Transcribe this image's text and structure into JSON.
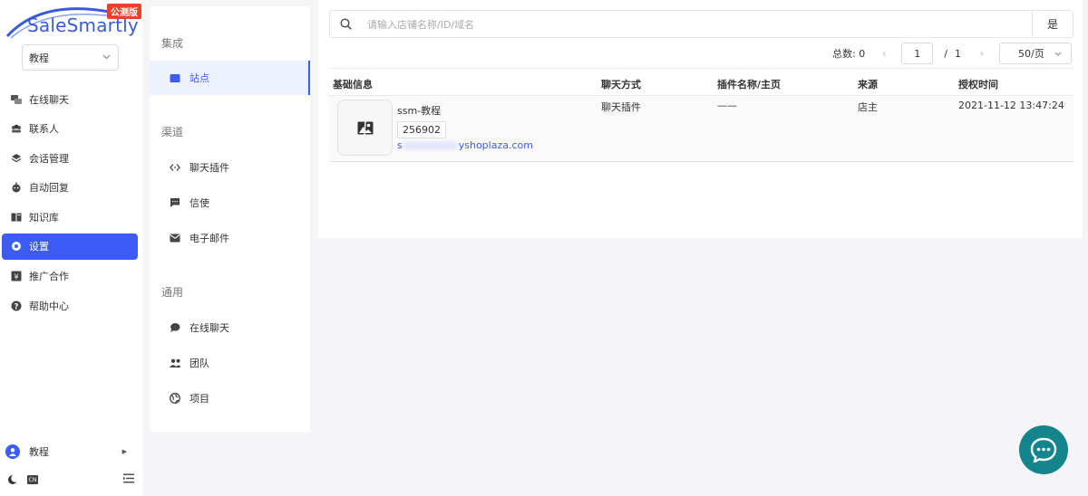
{
  "app": {
    "logo_text": "SaleSmartly",
    "beta_badge": "公测版",
    "brand_color": "#3a5bd9"
  },
  "workspace_select": {
    "value": "教程"
  },
  "sidebar": {
    "items": [
      {
        "label": "在线聊天",
        "icon": "chat-icon"
      },
      {
        "label": "联系人",
        "icon": "contacts-icon"
      },
      {
        "label": "会话管理",
        "icon": "layers-icon"
      },
      {
        "label": "自动回复",
        "icon": "robot-icon"
      },
      {
        "label": "知识库",
        "icon": "book-icon"
      },
      {
        "label": "设置",
        "icon": "settings-icon",
        "active": true
      },
      {
        "label": "推广合作",
        "icon": "partner-icon"
      },
      {
        "label": "帮助中心",
        "icon": "help-icon"
      }
    ],
    "user_label": "教程",
    "lang": "CN"
  },
  "submenu": {
    "sections": [
      {
        "title": "集成",
        "items": [
          {
            "label": "站点",
            "icon": "store-icon",
            "active": true
          }
        ]
      },
      {
        "title": "渠道",
        "items": [
          {
            "label": "聊天插件",
            "icon": "code-icon"
          },
          {
            "label": "信使",
            "icon": "message-icon"
          },
          {
            "label": "电子邮件",
            "icon": "mail-icon"
          }
        ]
      },
      {
        "title": "通用",
        "items": [
          {
            "label": "在线聊天",
            "icon": "chat-bubble-icon"
          },
          {
            "label": "团队",
            "icon": "team-icon"
          },
          {
            "label": "项目",
            "icon": "globe-icon"
          }
        ]
      }
    ]
  },
  "search": {
    "placeholder": "请输入店铺名称/ID/域名",
    "button": "是"
  },
  "pagination": {
    "total_label": "总数: 0",
    "current_page": "1",
    "separator": "/",
    "total_pages": "1",
    "page_size": "50/页"
  },
  "table": {
    "headers": [
      "基础信息",
      "聊天方式",
      "插件名称/主页",
      "来源",
      "授权时间"
    ],
    "rows": [
      {
        "name": "ssm-教程",
        "id": "256902",
        "url_prefix": "s",
        "url_suffix": "yshoplaza.com",
        "chat_method": "聊天插件",
        "plugin": "——",
        "source": "店主",
        "auth_time": "2021-11-12 13:47:24"
      }
    ]
  },
  "colors": {
    "accent": "#3d5bf5",
    "fab": "#14858b"
  }
}
